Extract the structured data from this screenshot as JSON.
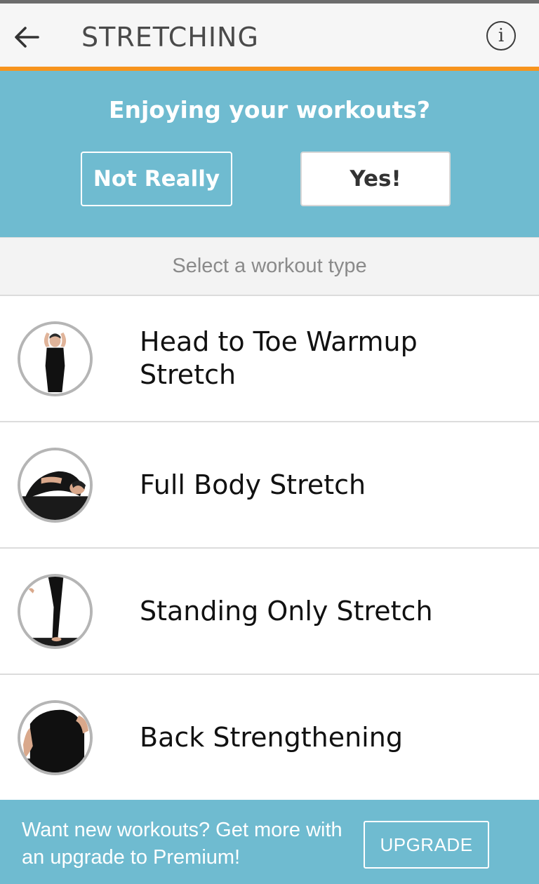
{
  "app_bar": {
    "back_icon": "arrow-left-icon",
    "title": "STRETCHING",
    "info_icon": "info-icon",
    "info_glyph": "i",
    "accent_color": "#f7941d"
  },
  "rating_prompt": {
    "question": "Enjoying your workouts?",
    "not_really_label": "Not Really",
    "yes_label": "Yes!",
    "background_color": "#6fbbd0"
  },
  "section": {
    "header": "Select a workout type"
  },
  "workouts": [
    {
      "label": "Head to Toe Warmup Stretch",
      "thumbnail": "head-to-toe-thumbnail"
    },
    {
      "label": "Full Body Stretch",
      "thumbnail": "full-body-thumbnail"
    },
    {
      "label": "Standing Only Stretch",
      "thumbnail": "standing-only-thumbnail"
    },
    {
      "label": "Back Strengthening",
      "thumbnail": "back-strengthening-thumbnail"
    }
  ],
  "upgrade": {
    "message": "Want new workouts? Get more with an upgrade to Premium!",
    "button_label": "UPGRADE"
  }
}
